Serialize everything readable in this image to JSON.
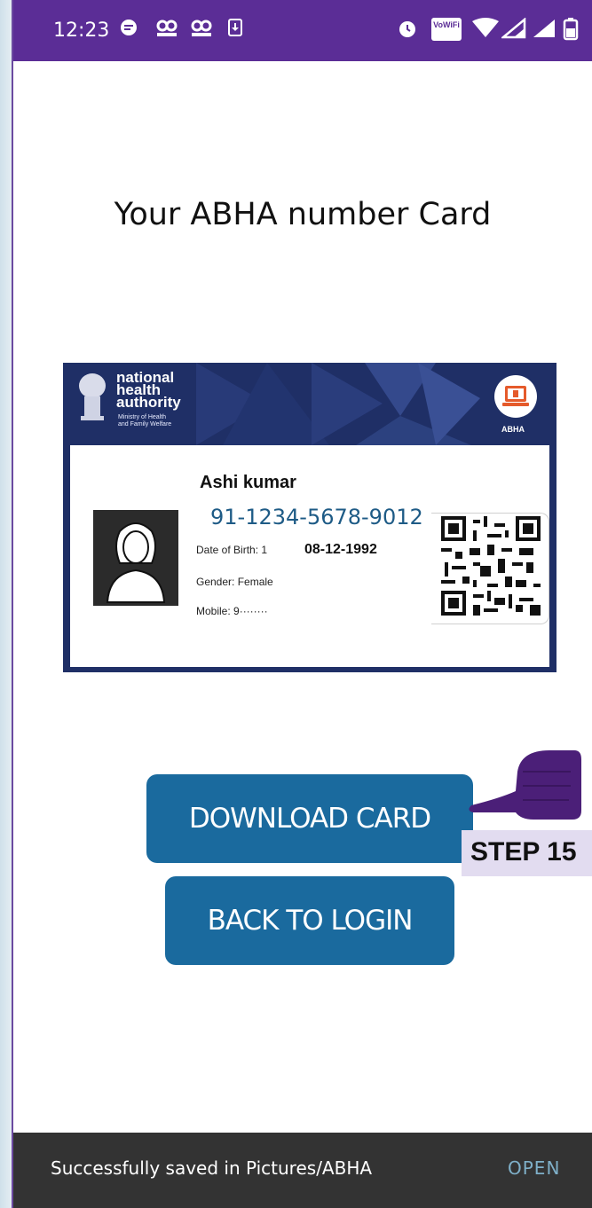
{
  "status_bar": {
    "time": "12:23",
    "left_icons": [
      "chat-bubble-icon",
      "hood-icon",
      "hood-icon",
      "download-box-icon"
    ],
    "right_icons": [
      "alarm-icon",
      "vowifi-icon",
      "wifi-icon",
      "signal-icon",
      "signal-icon",
      "battery-icon"
    ],
    "vowifi_text": "VoWiFi",
    "color": "#5b2d96"
  },
  "page": {
    "title": "Your ABHA number Card"
  },
  "card": {
    "org_name": [
      "national",
      "health",
      "authority"
    ],
    "org_sub": [
      "Ministry of Health",
      "and Family Welfare"
    ],
    "abha_label": "ABHA",
    "holder_name": "Ashi kumar",
    "abha_number": "91-1234-5678-9012",
    "dob_label": "Date of Birth: 1",
    "dob_value": "08-12-1992",
    "gender": "Gender: Female",
    "mobile": "Mobile: 9········"
  },
  "buttons": {
    "download": "DOWNLOAD CARD",
    "back": "BACK TO LOGIN"
  },
  "annotation": {
    "step": "STEP 15"
  },
  "snackbar": {
    "message": "Successfully saved in Pictures/ABHA",
    "action": "OPEN"
  },
  "colors": {
    "button": "#1a6a9e",
    "card_frame": "#1f2f66",
    "abha_number": "#1e5b86",
    "snackbar": "#333333",
    "hand": "#4b1f78"
  }
}
